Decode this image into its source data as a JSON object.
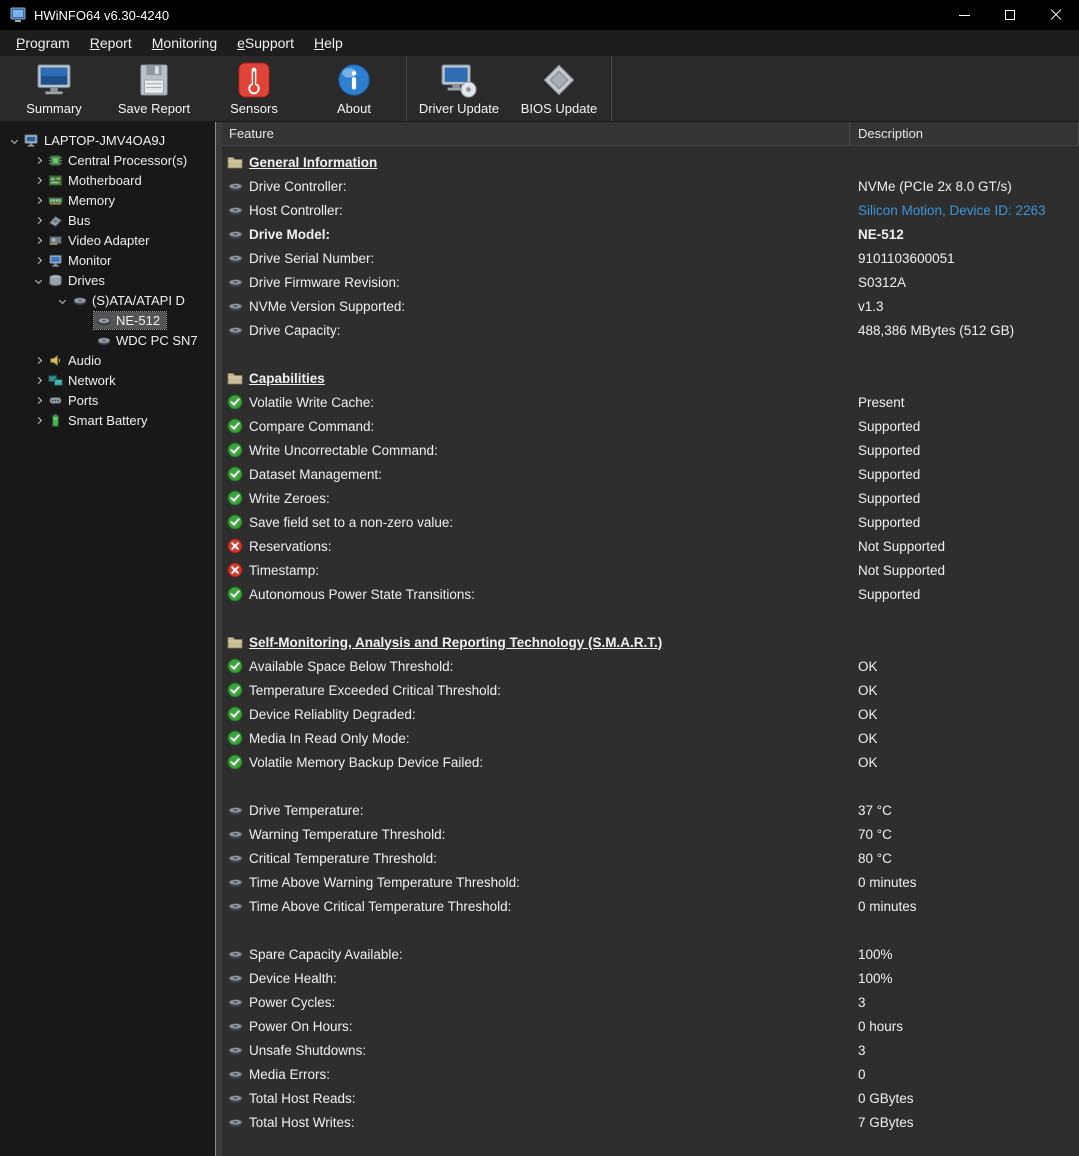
{
  "window": {
    "title": "HWiNFO64 v6.30-4240"
  },
  "colors": {
    "accent_link": "#3a96d9",
    "check_green": "#3fa23c",
    "cross_red": "#cf3a30",
    "selected_bg": "#545454"
  },
  "menubar": {
    "items": [
      "Program",
      "Report",
      "Monitoring",
      "eSupport",
      "Help"
    ]
  },
  "toolbar": {
    "buttons": [
      {
        "label": "Summary",
        "icon": "summary-icon",
        "group": 1
      },
      {
        "label": "Save Report",
        "icon": "save-report-icon",
        "group": 1
      },
      {
        "label": "Sensors",
        "icon": "sensors-icon",
        "group": 1
      },
      {
        "label": "About",
        "icon": "about-icon",
        "group": 1
      },
      {
        "label": "Driver Update",
        "icon": "driver-update-icon",
        "group": 2
      },
      {
        "label": "BIOS Update",
        "icon": "bios-update-icon",
        "group": 2
      }
    ]
  },
  "tree": {
    "items": [
      {
        "label": "LAPTOP-JMV4OA9J",
        "level": 0,
        "arrow": "expanded",
        "icon": "computer-icon"
      },
      {
        "label": "Central Processor(s)",
        "level": 1,
        "arrow": "collapsed",
        "icon": "cpu-icon"
      },
      {
        "label": "Motherboard",
        "level": 1,
        "arrow": "collapsed",
        "icon": "motherboard-icon"
      },
      {
        "label": "Memory",
        "level": 1,
        "arrow": "collapsed",
        "icon": "memory-icon"
      },
      {
        "label": "Bus",
        "level": 1,
        "arrow": "collapsed",
        "icon": "bus-icon"
      },
      {
        "label": "Video Adapter",
        "level": 1,
        "arrow": "collapsed",
        "icon": "video-adapter-icon"
      },
      {
        "label": "Monitor",
        "level": 1,
        "arrow": "collapsed",
        "icon": "monitor-icon"
      },
      {
        "label": "Drives",
        "level": 1,
        "arrow": "expanded",
        "icon": "drives-icon"
      },
      {
        "label": "(S)ATA/ATAPI D",
        "level": 2,
        "arrow": "expanded",
        "icon": "sata-controller-icon"
      },
      {
        "label": "NE-512",
        "level": 3,
        "arrow": "none",
        "icon": "disk-icon",
        "selected": true
      },
      {
        "label": "WDC PC SN7",
        "level": 3,
        "arrow": "none",
        "icon": "disk-icon"
      },
      {
        "label": "Audio",
        "level": 1,
        "arrow": "collapsed",
        "icon": "audio-icon"
      },
      {
        "label": "Network",
        "level": 1,
        "arrow": "collapsed",
        "icon": "network-icon"
      },
      {
        "label": "Ports",
        "level": 1,
        "arrow": "collapsed",
        "icon": "ports-icon"
      },
      {
        "label": "Smart Battery",
        "level": 1,
        "arrow": "collapsed",
        "icon": "battery-icon"
      }
    ]
  },
  "details": {
    "columns": {
      "feature": "Feature",
      "description": "Description"
    },
    "rows": [
      {
        "type": "section",
        "icon": "folder-icon",
        "label": "General Information"
      },
      {
        "type": "item",
        "icon": "drive-icon",
        "label": "Drive Controller:",
        "value": "NVMe (PCIe 2x 8.0 GT/s)"
      },
      {
        "type": "item",
        "icon": "drive-icon",
        "label": "Host Controller:",
        "value": "Silicon Motion, Device ID: 2263",
        "value_style": "link"
      },
      {
        "type": "item",
        "icon": "drive-icon",
        "label": "Drive Model:",
        "value": "NE-512",
        "emphasis": true
      },
      {
        "type": "item",
        "icon": "drive-icon",
        "label": "Drive Serial Number:",
        "value": "9101103600051"
      },
      {
        "type": "item",
        "icon": "drive-icon",
        "label": "Drive Firmware Revision:",
        "value": "S0312A"
      },
      {
        "type": "item",
        "icon": "drive-icon",
        "label": "NVMe Version Supported:",
        "value": "v1.3"
      },
      {
        "type": "item",
        "icon": "drive-icon",
        "label": "Drive Capacity:",
        "value": "488,386 MBytes (512 GB)"
      },
      {
        "type": "spacer"
      },
      {
        "type": "section",
        "icon": "folder-icon",
        "label": "Capabilities"
      },
      {
        "type": "item",
        "icon": "check-icon",
        "label": "Volatile Write Cache:",
        "value": "Present"
      },
      {
        "type": "item",
        "icon": "check-icon",
        "label": "Compare Command:",
        "value": "Supported"
      },
      {
        "type": "item",
        "icon": "check-icon",
        "label": "Write Uncorrectable Command:",
        "value": "Supported"
      },
      {
        "type": "item",
        "icon": "check-icon",
        "label": "Dataset Management:",
        "value": "Supported"
      },
      {
        "type": "item",
        "icon": "check-icon",
        "label": "Write Zeroes:",
        "value": "Supported"
      },
      {
        "type": "item",
        "icon": "check-icon",
        "label": "Save field set to a non-zero value:",
        "value": "Supported"
      },
      {
        "type": "item",
        "icon": "cross-icon",
        "label": "Reservations:",
        "value": "Not Supported"
      },
      {
        "type": "item",
        "icon": "cross-icon",
        "label": "Timestamp:",
        "value": "Not Supported"
      },
      {
        "type": "item",
        "icon": "check-icon",
        "label": "Autonomous Power State Transitions:",
        "value": "Supported"
      },
      {
        "type": "spacer"
      },
      {
        "type": "section",
        "icon": "folder-icon",
        "label": "Self-Monitoring, Analysis and Reporting Technology (S.M.A.R.T.)"
      },
      {
        "type": "item",
        "icon": "check-icon",
        "label": "Available Space Below Threshold:",
        "value": "OK"
      },
      {
        "type": "item",
        "icon": "check-icon",
        "label": "Temperature Exceeded Critical Threshold:",
        "value": "OK"
      },
      {
        "type": "item",
        "icon": "check-icon",
        "label": "Device Reliablity Degraded:",
        "value": "OK"
      },
      {
        "type": "item",
        "icon": "check-icon",
        "label": "Media In Read Only Mode:",
        "value": "OK"
      },
      {
        "type": "item",
        "icon": "check-icon",
        "label": "Volatile Memory Backup Device Failed:",
        "value": "OK"
      },
      {
        "type": "spacer"
      },
      {
        "type": "item",
        "icon": "drive-icon",
        "label": "Drive Temperature:",
        "value": "37 °C"
      },
      {
        "type": "item",
        "icon": "drive-icon",
        "label": "Warning Temperature Threshold:",
        "value": "70 °C"
      },
      {
        "type": "item",
        "icon": "drive-icon",
        "label": "Critical Temperature Threshold:",
        "value": "80 °C"
      },
      {
        "type": "item",
        "icon": "drive-icon",
        "label": "Time Above Warning Temperature Threshold:",
        "value": "0 minutes"
      },
      {
        "type": "item",
        "icon": "drive-icon",
        "label": "Time Above Critical Temperature Threshold:",
        "value": "0 minutes"
      },
      {
        "type": "spacer"
      },
      {
        "type": "item",
        "icon": "drive-icon",
        "label": "Spare Capacity Available:",
        "value": "100%"
      },
      {
        "type": "item",
        "icon": "drive-icon",
        "label": "Device Health:",
        "value": "100%"
      },
      {
        "type": "item",
        "icon": "drive-icon",
        "label": "Power Cycles:",
        "value": "3"
      },
      {
        "type": "item",
        "icon": "drive-icon",
        "label": "Power On Hours:",
        "value": "0 hours"
      },
      {
        "type": "item",
        "icon": "drive-icon",
        "label": "Unsafe Shutdowns:",
        "value": "3"
      },
      {
        "type": "item",
        "icon": "drive-icon",
        "label": "Media Errors:",
        "value": "0"
      },
      {
        "type": "item",
        "icon": "drive-icon",
        "label": "Total Host Reads:",
        "value": "0 GBytes"
      },
      {
        "type": "item",
        "icon": "drive-icon",
        "label": "Total Host Writes:",
        "value": "7 GBytes"
      }
    ]
  }
}
